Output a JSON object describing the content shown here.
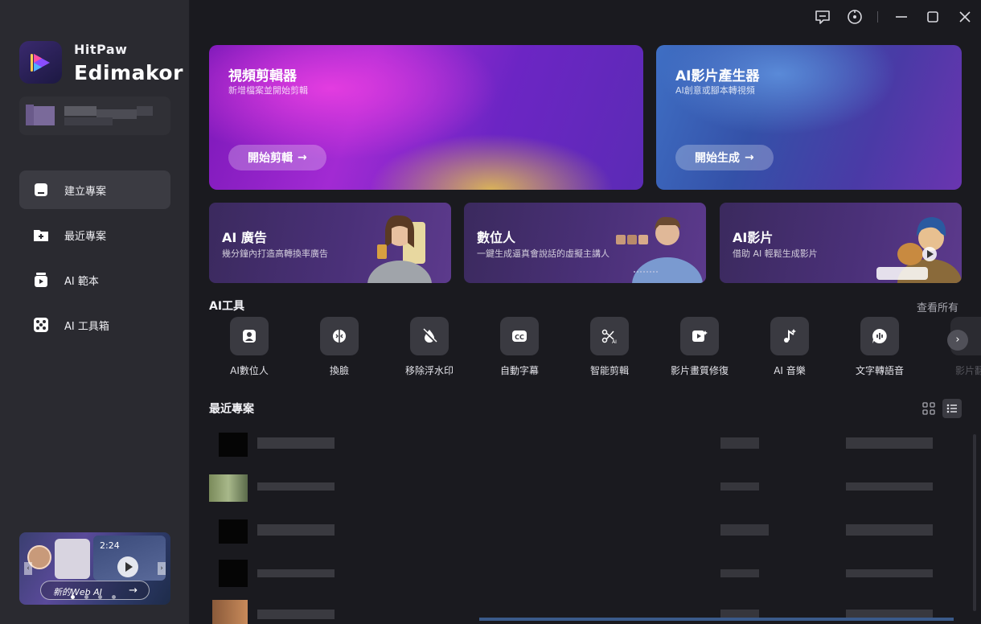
{
  "app": {
    "brand_small": "HitPaw",
    "brand_big": "Edimakor"
  },
  "sidebar": {
    "items": [
      {
        "label": "建立專案",
        "icon": "new-project-icon",
        "active": true
      },
      {
        "label": "最近專案",
        "icon": "recent-project-icon",
        "active": false
      },
      {
        "label": "AI 範本",
        "icon": "ai-template-icon",
        "active": false
      },
      {
        "label": "AI 工具箱",
        "icon": "ai-toolbox-icon",
        "active": false
      }
    ],
    "promo": {
      "label": "新的Web AI",
      "time": "2:24"
    }
  },
  "hero": [
    {
      "title": "視頻剪輯器",
      "subtitle": "新增檔案並開始剪輯",
      "button": "開始剪輯"
    },
    {
      "title": "AI影片產生器",
      "subtitle": "AI創意或腳本轉視頻",
      "button": "開始生成"
    }
  ],
  "features": [
    {
      "title": "AI 廣告",
      "subtitle": "幾分鐘內打造高轉換率廣告"
    },
    {
      "title": "數位人",
      "subtitle": "一鍵生成逼真會說話的虛擬主講人"
    },
    {
      "title": "AI影片",
      "subtitle": "借助 AI 輕鬆生成影片"
    }
  ],
  "ai_tools": {
    "title": "AI工具",
    "see_all": "查看所有",
    "items": [
      {
        "label": "AI數位人",
        "icon": "avatar-icon"
      },
      {
        "label": "換臉",
        "icon": "face-swap-icon"
      },
      {
        "label": "移除浮水印",
        "icon": "watermark-remove-icon"
      },
      {
        "label": "自動字幕",
        "icon": "cc-icon"
      },
      {
        "label": "智能剪輯",
        "icon": "ai-cut-icon"
      },
      {
        "label": "影片畫質修復",
        "icon": "video-enhance-icon"
      },
      {
        "label": "AI 音樂",
        "icon": "music-icon"
      },
      {
        "label": "文字轉語音",
        "icon": "tts-icon"
      },
      {
        "label": "影片翻",
        "icon": "translate-icon"
      }
    ]
  },
  "recent": {
    "title": "最近專案"
  },
  "colors": {
    "bg": "#1a1a1f",
    "sidebar": "#2a2a30",
    "card": "#3a3a41"
  }
}
